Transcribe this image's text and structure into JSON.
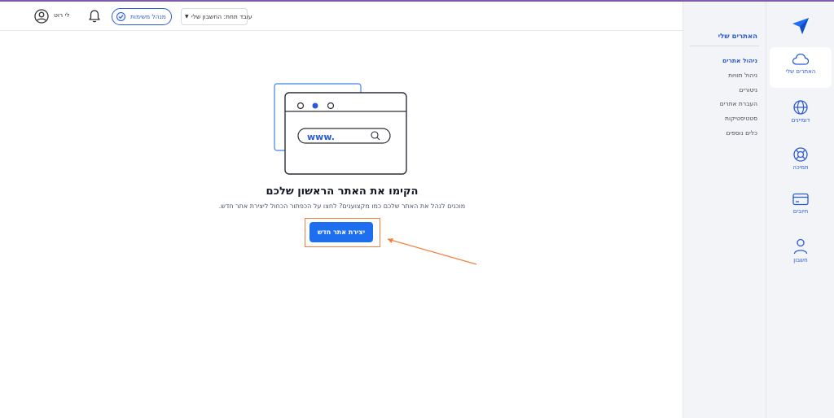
{
  "header": {
    "user_name": "לי רוט",
    "task_manager": "מנהל משימות",
    "account_selector": "עובד תחת: החשבון שלי"
  },
  "rail": {
    "items": [
      {
        "label": "האתרים שלי",
        "icon": "cloud-icon",
        "active": true
      },
      {
        "label": "דומיינים",
        "icon": "globe-icon"
      },
      {
        "label": "תמיכה",
        "icon": "lifebuoy-icon"
      },
      {
        "label": "חיובים",
        "icon": "credit-card-icon"
      },
      {
        "label": "חשבון",
        "icon": "user-icon"
      }
    ]
  },
  "subnav": {
    "title": "האתרים שלי",
    "items": [
      {
        "label": "ניהול אתרים",
        "active": true
      },
      {
        "label": "ניהול תוויות"
      },
      {
        "label": "ניטורים"
      },
      {
        "label": "העברת אתרים"
      },
      {
        "label": "סטטיסטיקות"
      },
      {
        "label": "כלים נוספים"
      }
    ]
  },
  "main": {
    "illustration_text": "www.",
    "title": "הקימו את האתר הראשון שלכם",
    "subtitle": "מוכנים לנהל את האתר שלכם כמו מקצוענים? לחצו על הכפתור הכחול ליצירת אתר חדש.",
    "cta": "יצירת אתר חדש"
  },
  "colors": {
    "brand_blue": "#1e6ff0",
    "accent_link": "#2a5bd7",
    "highlight_orange": "#f27f3d",
    "top_stripe": "#7b5ea7"
  }
}
